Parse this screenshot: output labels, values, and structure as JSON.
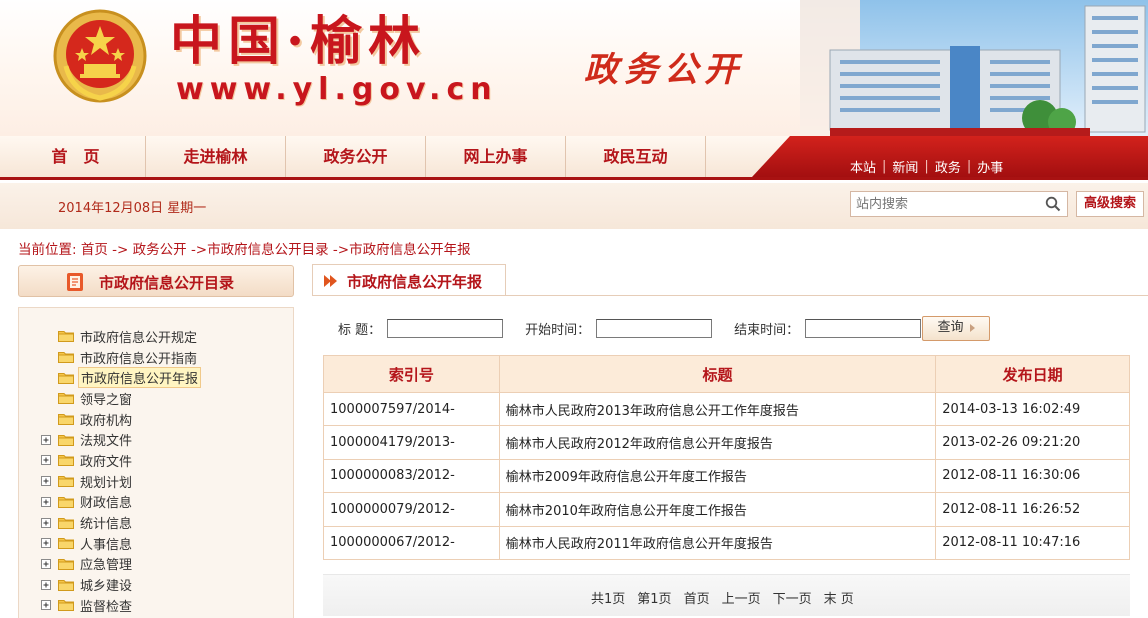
{
  "header": {
    "site_title": "中国·榆林",
    "site_url": "www.yl.gov.cn",
    "slogan": "政务公开"
  },
  "nav": {
    "items": [
      {
        "label": "首　页"
      },
      {
        "label": "走进榆林"
      },
      {
        "label": "政务公开"
      },
      {
        "label": "网上办事"
      },
      {
        "label": "政民互动"
      }
    ]
  },
  "quick_links": [
    "本站",
    "新闻",
    "政务",
    "办事"
  ],
  "info_bar": {
    "date": "2014年12月08日 星期一",
    "search_placeholder": "站内搜索",
    "advanced_search_label": "高级搜索"
  },
  "breadcrumb": {
    "prefix": "当前位置:",
    "home": "首页",
    "sep1": "->",
    "level2": "政务公开",
    "sep2": "->",
    "level3": "市政府信息公开目录",
    "sep3": "->",
    "level4": "市政府信息公开年报"
  },
  "sidebar": {
    "title": "市政府信息公开目录",
    "items": [
      {
        "label": "市政府信息公开规定",
        "expandable": false
      },
      {
        "label": "市政府信息公开指南",
        "expandable": false
      },
      {
        "label": "市政府信息公开年报",
        "expandable": false,
        "active": true
      },
      {
        "label": "领导之窗",
        "expandable": false
      },
      {
        "label": "政府机构",
        "expandable": false
      },
      {
        "label": "法规文件",
        "expandable": true
      },
      {
        "label": "政府文件",
        "expandable": true
      },
      {
        "label": "规划计划",
        "expandable": true
      },
      {
        "label": "财政信息",
        "expandable": true
      },
      {
        "label": "统计信息",
        "expandable": true
      },
      {
        "label": "人事信息",
        "expandable": true
      },
      {
        "label": "应急管理",
        "expandable": true
      },
      {
        "label": "城乡建设",
        "expandable": true
      },
      {
        "label": "监督检查",
        "expandable": true
      }
    ]
  },
  "main": {
    "tab_title": "市政府信息公开年报",
    "filters": {
      "title_label": "标 题：",
      "start_label": "开始时间：",
      "end_label": "结束时间：",
      "title_value": "",
      "start_value": "",
      "end_value": "",
      "query_label": "查询"
    },
    "table": {
      "headers": {
        "index": "索引号",
        "title": "标题",
        "date": "发布日期"
      },
      "rows": [
        {
          "index": "1000007597/2014-",
          "title": "榆林市人民政府2013年政府信息公开工作年度报告",
          "date": "2014-03-13 16:02:49"
        },
        {
          "index": "1000004179/2013-",
          "title": "榆林市人民政府2012年政府信息公开年度报告",
          "date": "2013-02-26 09:21:20"
        },
        {
          "index": "1000000083/2012-",
          "title": "榆林市2009年政府信息公开年度工作报告",
          "date": "2012-08-11 16:30:06"
        },
        {
          "index": "1000000079/2012-",
          "title": "榆林市2010年政府信息公开年度工作报告",
          "date": "2012-08-11 16:26:52"
        },
        {
          "index": "1000000067/2012-",
          "title": "榆林市人民政府2011年政府信息公开年度报告",
          "date": "2012-08-11 10:47:16"
        }
      ]
    },
    "pagination": {
      "total": "共1页",
      "current": "第1页",
      "first": "首页",
      "prev": "上一页",
      "next": "下一页",
      "last": "末 页"
    }
  },
  "colors": {
    "brand_red": "#b4151a",
    "nav_bg": "#f7e6d6",
    "table_header_bg": "#fcebd9"
  }
}
